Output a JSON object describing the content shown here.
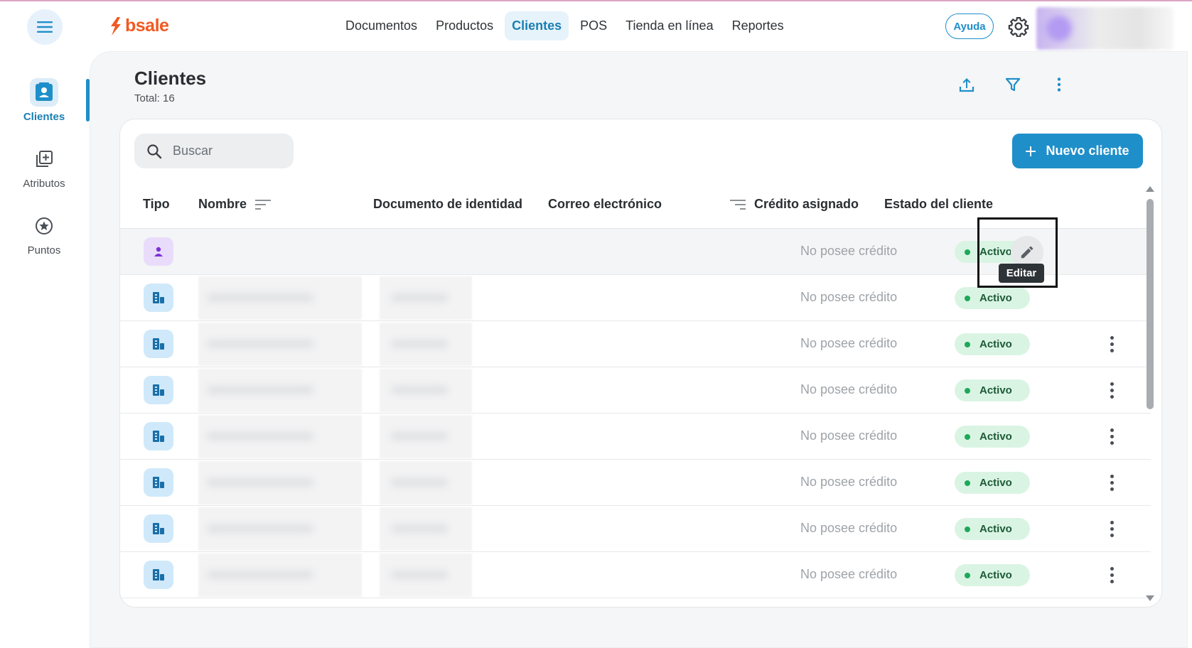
{
  "app": {
    "brand": "bsale",
    "brand_color": "#f05a22",
    "accent_color": "#1f8fc9"
  },
  "topnav": {
    "items": [
      {
        "label": "Documentos",
        "active": false
      },
      {
        "label": "Productos",
        "active": false
      },
      {
        "label": "Clientes",
        "active": true
      },
      {
        "label": "POS",
        "active": false
      },
      {
        "label": "Tienda en línea",
        "active": false
      },
      {
        "label": "Reportes",
        "active": false
      }
    ],
    "help_label": "Ayuda",
    "settings_icon": "gear-icon",
    "menu_icon": "hamburger-icon"
  },
  "sidebar": {
    "items": [
      {
        "label": "Clientes",
        "icon": "contact-card-icon",
        "active": true
      },
      {
        "label": "Atributos",
        "icon": "add-box-icon",
        "active": false
      },
      {
        "label": "Puntos",
        "icon": "star-circle-icon",
        "active": false
      }
    ]
  },
  "page": {
    "title": "Clientes",
    "total": "Total: 16",
    "actions": [
      "upload-icon",
      "filter-icon",
      "more-vertical-icon"
    ]
  },
  "toolbar": {
    "search_placeholder": "Buscar",
    "new_button_label": "Nuevo cliente"
  },
  "table": {
    "columns": {
      "tipo": "Tipo",
      "nombre": "Nombre",
      "documento": "Documento de identidad",
      "correo": "Correo electrónico",
      "credito": "Crédito asignado",
      "estado": "Estado del cliente"
    },
    "rows": [
      {
        "type": "person",
        "credit": "No posee crédito",
        "status": "Activo"
      },
      {
        "type": "company",
        "credit": "No posee crédito",
        "status": "Activo"
      },
      {
        "type": "company",
        "credit": "No posee crédito",
        "status": "Activo"
      },
      {
        "type": "company",
        "credit": "No posee crédito",
        "status": "Activo"
      },
      {
        "type": "company",
        "credit": "No posee crédito",
        "status": "Activo"
      },
      {
        "type": "company",
        "credit": "No posee crédito",
        "status": "Activo"
      },
      {
        "type": "company",
        "credit": "No posee crédito",
        "status": "Activo"
      },
      {
        "type": "company",
        "credit": "No posee crédito",
        "status": "Activo"
      }
    ],
    "status_color": "#1ea85a"
  },
  "edit_tooltip": "Editar"
}
